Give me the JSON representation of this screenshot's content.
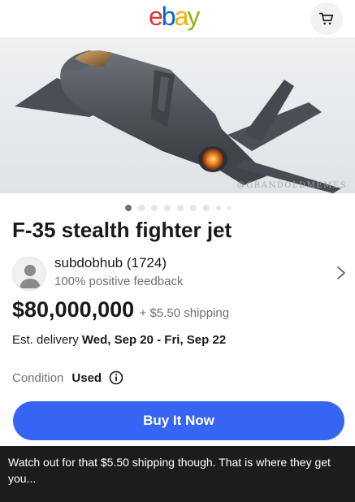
{
  "header": {
    "logo_letters": [
      {
        "char": "e",
        "color": "#e53238"
      },
      {
        "char": "b",
        "color": "#0064d2"
      },
      {
        "char": "a",
        "color": "#f5af02"
      },
      {
        "char": "y",
        "color": "#86b817"
      }
    ],
    "cart_icon": "shopping-cart-icon"
  },
  "hero": {
    "watermark": "@GRANDOLDMEMES",
    "image_subject": "f-35-fighter-jet"
  },
  "carousel": {
    "count": 9,
    "active_index": 0
  },
  "listing": {
    "title": "F-35 stealth fighter jet",
    "seller_name": "subdobhub (1724)",
    "seller_feedback": "100% positive feedback",
    "price": "$80,000,000",
    "shipping": "+ $5.50 shipping",
    "delivery_prefix": "Est. delivery ",
    "delivery_dates": "Wed, Sep 20 - Fri, Sep 22",
    "condition_label": "Condition",
    "condition_value": "Used",
    "buy_button": "Buy It Now"
  },
  "caption": {
    "text": "Watch out for that $5.50 shipping though. That is where they get you..."
  },
  "colors": {
    "buy_button": "#3665f3",
    "caption_bg": "#1c1c1c",
    "muted_text": "#707070"
  }
}
